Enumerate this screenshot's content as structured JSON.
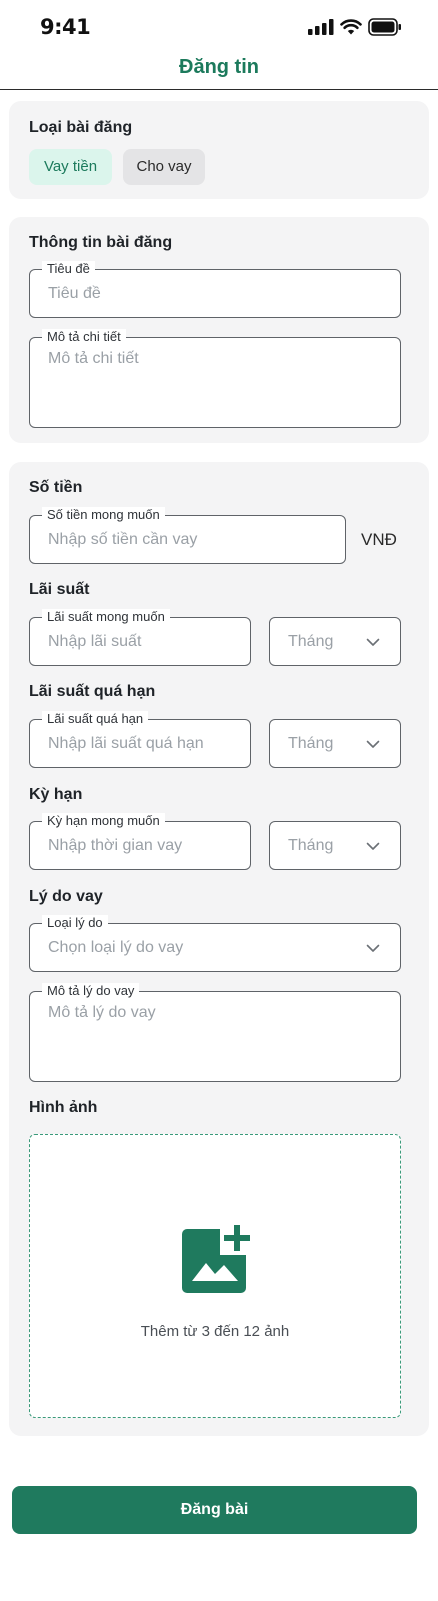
{
  "status_bar": {
    "time": "9:41"
  },
  "header": {
    "title": "Đăng tin"
  },
  "post_type": {
    "title": "Loại bài đăng",
    "options": [
      "Vay tiền",
      "Cho vay"
    ],
    "selected": "Vay tiền"
  },
  "post_info": {
    "title": "Thông tin bài đăng",
    "title_field": {
      "label": "Tiêu đề",
      "placeholder": "Tiêu đề"
    },
    "description_field": {
      "label": "Mô tả chi tiết",
      "placeholder": "Mô tả chi tiết"
    }
  },
  "amount": {
    "title": "Số tiền",
    "label": "Số tiền mong muốn",
    "placeholder": "Nhập số tiền cần vay",
    "unit": "VNĐ"
  },
  "interest": {
    "title": "Lãi suất",
    "label": "Lãi suất mong muốn",
    "placeholder": "Nhập lãi suất",
    "period": "Tháng"
  },
  "overdue_interest": {
    "title": "Lãi suất quá hạn",
    "label": "Lãi suất quá hạn",
    "placeholder": "Nhập lãi suất quá hạn",
    "period": "Tháng"
  },
  "term": {
    "title": "Kỳ hạn",
    "label": "Kỳ hạn mong muốn",
    "placeholder": "Nhập thời gian vay",
    "period": "Tháng"
  },
  "reason": {
    "title": "Lý do vay",
    "type_label": "Loại lý do",
    "type_placeholder": "Chọn loại lý do vay",
    "desc_label": "Mô tả lý do vay",
    "desc_placeholder": "Mô tả lý do vay"
  },
  "images": {
    "title": "Hình ảnh",
    "hint": "Thêm từ 3 đến 12 ảnh"
  },
  "submit_label": "Đăng bài",
  "colors": {
    "brand": "#1f7a5e",
    "chip_active_bg": "#dbf5ec",
    "card_bg": "#f4f4f5"
  }
}
